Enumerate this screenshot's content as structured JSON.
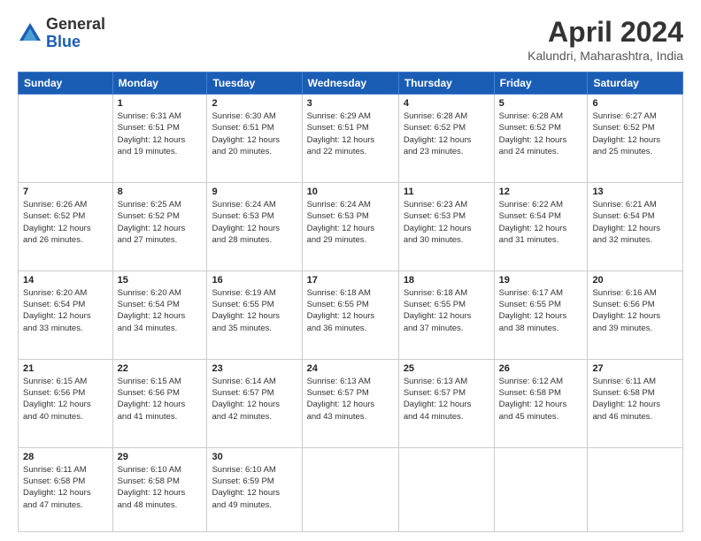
{
  "logo": {
    "general": "General",
    "blue": "Blue"
  },
  "title": "April 2024",
  "location": "Kalundri, Maharashtra, India",
  "headers": [
    "Sunday",
    "Monday",
    "Tuesday",
    "Wednesday",
    "Thursday",
    "Friday",
    "Saturday"
  ],
  "weeks": [
    [
      {
        "day": "",
        "info": ""
      },
      {
        "day": "1",
        "info": "Sunrise: 6:31 AM\nSunset: 6:51 PM\nDaylight: 12 hours\nand 19 minutes."
      },
      {
        "day": "2",
        "info": "Sunrise: 6:30 AM\nSunset: 6:51 PM\nDaylight: 12 hours\nand 20 minutes."
      },
      {
        "day": "3",
        "info": "Sunrise: 6:29 AM\nSunset: 6:51 PM\nDaylight: 12 hours\nand 22 minutes."
      },
      {
        "day": "4",
        "info": "Sunrise: 6:28 AM\nSunset: 6:52 PM\nDaylight: 12 hours\nand 23 minutes."
      },
      {
        "day": "5",
        "info": "Sunrise: 6:28 AM\nSunset: 6:52 PM\nDaylight: 12 hours\nand 24 minutes."
      },
      {
        "day": "6",
        "info": "Sunrise: 6:27 AM\nSunset: 6:52 PM\nDaylight: 12 hours\nand 25 minutes."
      }
    ],
    [
      {
        "day": "7",
        "info": "Sunrise: 6:26 AM\nSunset: 6:52 PM\nDaylight: 12 hours\nand 26 minutes."
      },
      {
        "day": "8",
        "info": "Sunrise: 6:25 AM\nSunset: 6:52 PM\nDaylight: 12 hours\nand 27 minutes."
      },
      {
        "day": "9",
        "info": "Sunrise: 6:24 AM\nSunset: 6:53 PM\nDaylight: 12 hours\nand 28 minutes."
      },
      {
        "day": "10",
        "info": "Sunrise: 6:24 AM\nSunset: 6:53 PM\nDaylight: 12 hours\nand 29 minutes."
      },
      {
        "day": "11",
        "info": "Sunrise: 6:23 AM\nSunset: 6:53 PM\nDaylight: 12 hours\nand 30 minutes."
      },
      {
        "day": "12",
        "info": "Sunrise: 6:22 AM\nSunset: 6:54 PM\nDaylight: 12 hours\nand 31 minutes."
      },
      {
        "day": "13",
        "info": "Sunrise: 6:21 AM\nSunset: 6:54 PM\nDaylight: 12 hours\nand 32 minutes."
      }
    ],
    [
      {
        "day": "14",
        "info": "Sunrise: 6:20 AM\nSunset: 6:54 PM\nDaylight: 12 hours\nand 33 minutes."
      },
      {
        "day": "15",
        "info": "Sunrise: 6:20 AM\nSunset: 6:54 PM\nDaylight: 12 hours\nand 34 minutes."
      },
      {
        "day": "16",
        "info": "Sunrise: 6:19 AM\nSunset: 6:55 PM\nDaylight: 12 hours\nand 35 minutes."
      },
      {
        "day": "17",
        "info": "Sunrise: 6:18 AM\nSunset: 6:55 PM\nDaylight: 12 hours\nand 36 minutes."
      },
      {
        "day": "18",
        "info": "Sunrise: 6:18 AM\nSunset: 6:55 PM\nDaylight: 12 hours\nand 37 minutes."
      },
      {
        "day": "19",
        "info": "Sunrise: 6:17 AM\nSunset: 6:55 PM\nDaylight: 12 hours\nand 38 minutes."
      },
      {
        "day": "20",
        "info": "Sunrise: 6:16 AM\nSunset: 6:56 PM\nDaylight: 12 hours\nand 39 minutes."
      }
    ],
    [
      {
        "day": "21",
        "info": "Sunrise: 6:15 AM\nSunset: 6:56 PM\nDaylight: 12 hours\nand 40 minutes."
      },
      {
        "day": "22",
        "info": "Sunrise: 6:15 AM\nSunset: 6:56 PM\nDaylight: 12 hours\nand 41 minutes."
      },
      {
        "day": "23",
        "info": "Sunrise: 6:14 AM\nSunset: 6:57 PM\nDaylight: 12 hours\nand 42 minutes."
      },
      {
        "day": "24",
        "info": "Sunrise: 6:13 AM\nSunset: 6:57 PM\nDaylight: 12 hours\nand 43 minutes."
      },
      {
        "day": "25",
        "info": "Sunrise: 6:13 AM\nSunset: 6:57 PM\nDaylight: 12 hours\nand 44 minutes."
      },
      {
        "day": "26",
        "info": "Sunrise: 6:12 AM\nSunset: 6:58 PM\nDaylight: 12 hours\nand 45 minutes."
      },
      {
        "day": "27",
        "info": "Sunrise: 6:11 AM\nSunset: 6:58 PM\nDaylight: 12 hours\nand 46 minutes."
      }
    ],
    [
      {
        "day": "28",
        "info": "Sunrise: 6:11 AM\nSunset: 6:58 PM\nDaylight: 12 hours\nand 47 minutes."
      },
      {
        "day": "29",
        "info": "Sunrise: 6:10 AM\nSunset: 6:58 PM\nDaylight: 12 hours\nand 48 minutes."
      },
      {
        "day": "30",
        "info": "Sunrise: 6:10 AM\nSunset: 6:59 PM\nDaylight: 12 hours\nand 49 minutes."
      },
      {
        "day": "",
        "info": ""
      },
      {
        "day": "",
        "info": ""
      },
      {
        "day": "",
        "info": ""
      },
      {
        "day": "",
        "info": ""
      }
    ]
  ]
}
